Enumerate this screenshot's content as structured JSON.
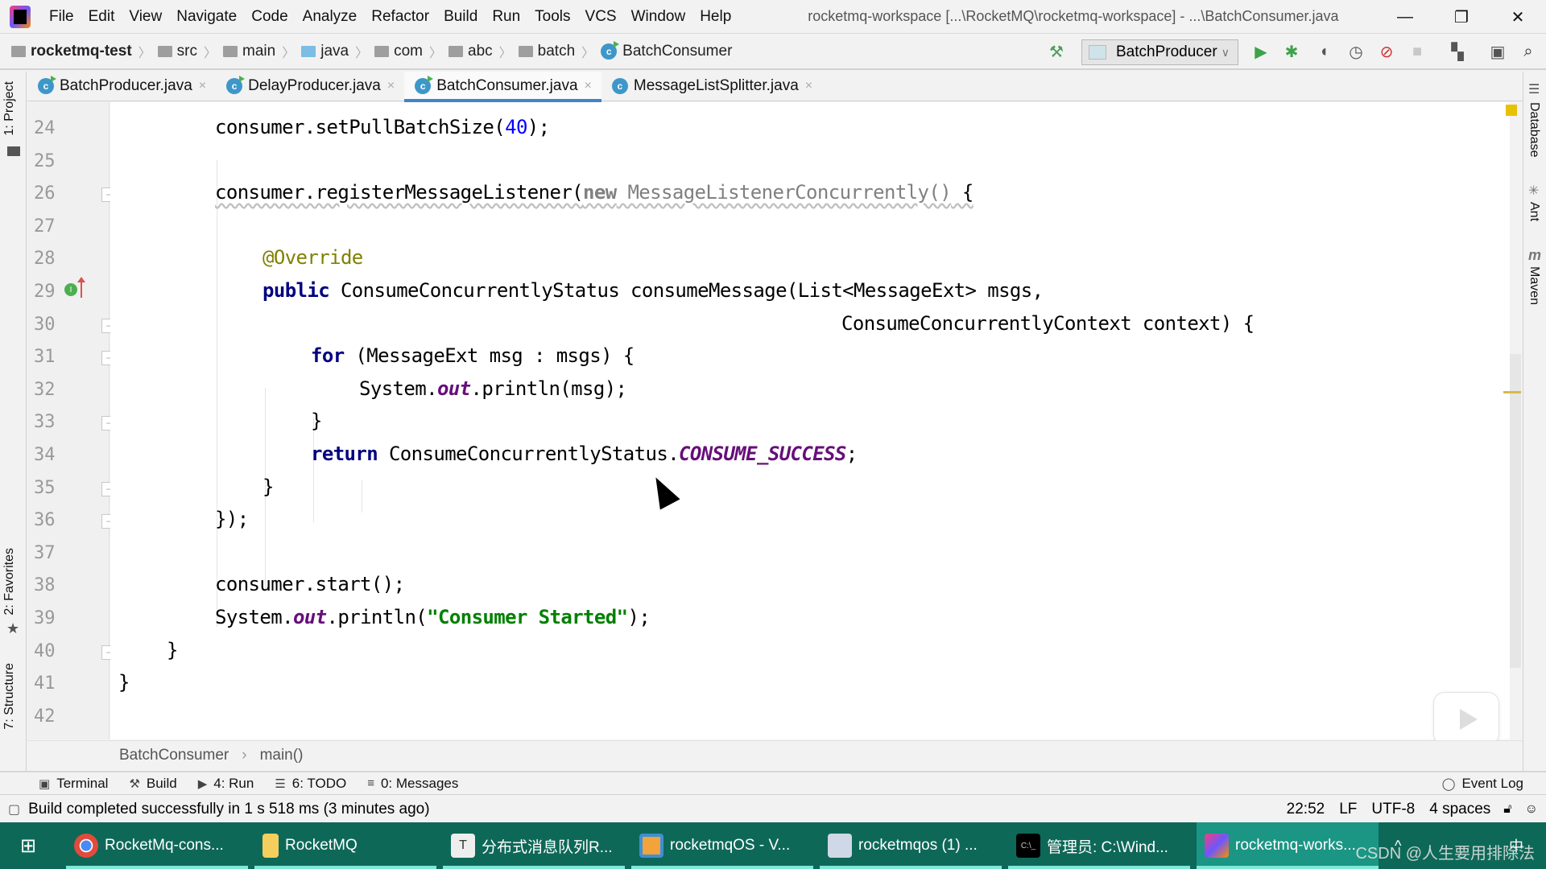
{
  "window": {
    "title": "rocketmq-workspace [...\\RocketMQ\\rocketmq-workspace] - ...\\BatchConsumer.java",
    "controls": {
      "minimize": "—",
      "restore": "❐",
      "close": "✕"
    }
  },
  "menu": [
    "File",
    "Edit",
    "View",
    "Navigate",
    "Code",
    "Analyze",
    "Refactor",
    "Build",
    "Run",
    "Tools",
    "VCS",
    "Window",
    "Help"
  ],
  "breadcrumb": [
    {
      "label": "rocketmq-test",
      "icon": "module-folder-icon"
    },
    {
      "label": "src",
      "icon": "folder-icon"
    },
    {
      "label": "main",
      "icon": "folder-icon"
    },
    {
      "label": "java",
      "icon": "source-folder-icon"
    },
    {
      "label": "com",
      "icon": "package-icon"
    },
    {
      "label": "abc",
      "icon": "package-icon"
    },
    {
      "label": "batch",
      "icon": "package-icon"
    },
    {
      "label": "BatchConsumer",
      "icon": "java-class-icon"
    }
  ],
  "toolbar": {
    "run_config": "BatchProducer",
    "icons": [
      "build-hammer-icon",
      "run-icon",
      "debug-icon",
      "coverage-icon",
      "profile-icon",
      "attach-debugger-icon",
      "stop-icon",
      "project-structure-icon",
      "sdk-icon",
      "search-icon"
    ]
  },
  "left_strip": [
    "1: Project",
    "2: Favorites",
    "7: Structure"
  ],
  "right_strip": [
    "Database",
    "Ant",
    "Maven"
  ],
  "tabs": [
    {
      "label": "BatchProducer.java",
      "active": false
    },
    {
      "label": "DelayProducer.java",
      "active": false
    },
    {
      "label": "BatchConsumer.java",
      "active": true
    },
    {
      "label": "MessageListSplitter.java",
      "active": false
    }
  ],
  "tab_close": "×",
  "editor": {
    "line_numbers": [
      "24",
      "25",
      "26",
      "27",
      "28",
      "29",
      "30",
      "31",
      "32",
      "33",
      "34",
      "35",
      "36",
      "37",
      "38",
      "39",
      "40",
      "41",
      "42"
    ],
    "lines": {
      "l24_a": "consumer.setPullBatchSize(",
      "l24_num": "40",
      "l24_b": ");",
      "l26_a": "consumer.registerMessageListener(",
      "l26_new": "new",
      "l26_cls": " MessageListenerConcurrently()",
      "l26_b": " {",
      "l28": "@Override",
      "l29_kw": "public",
      "l29_rest": " ConsumeConcurrentlyStatus consumeMessage(List<MessageExt> msgs,",
      "l30": "ConsumeConcurrentlyContext context) {",
      "l31_kw": "for",
      "l31_rest": " (MessageExt msg : msgs) {",
      "l32_a": "System.",
      "l32_out": "out",
      "l32_b": ".println(msg);",
      "l33": "}",
      "l34_kw": "return",
      "l34_a": " ConsumeConcurrentlyStatus.",
      "l34_const": "CONSUME_SUCCESS",
      "l34_b": ";",
      "l35": "}",
      "l36": "});",
      "l38": "consumer.start();",
      "l39_a": "System.",
      "l39_out": "out",
      "l39_b": ".println(",
      "l39_str": "\"Consumer Started\"",
      "l39_c": ");",
      "l40": "}",
      "l41": "}"
    },
    "gutter_marker_line": "29",
    "gutter_marker_label": "I"
  },
  "editor_breadcrumb": [
    "BatchConsumer",
    "main()"
  ],
  "tool_windows": [
    {
      "label": "Terminal",
      "icon": "terminal-icon"
    },
    {
      "label": "Build",
      "icon": "build-icon"
    },
    {
      "label": "4: Run",
      "icon": "run-icon"
    },
    {
      "label": "6: TODO",
      "icon": "todo-icon"
    },
    {
      "label": "0: Messages",
      "icon": "messages-icon"
    }
  ],
  "event_log": "Event Log",
  "status": {
    "message": "Build completed successfully in 1 s 518 ms (3 minutes ago)",
    "position": "22:52",
    "line_sep": "LF",
    "encoding": "UTF-8",
    "indent": "4 spaces"
  },
  "taskbar": {
    "items": [
      {
        "label": "RocketMq-cons...",
        "icon": "chrome-icon",
        "active": false
      },
      {
        "label": "RocketMQ",
        "icon": "file-explorer-icon",
        "active": false
      },
      {
        "label": "分布式消息队列R...",
        "icon": "typora-icon",
        "active": false
      },
      {
        "label": "rocketmqOS - V...",
        "icon": "virtualbox-icon",
        "active": false
      },
      {
        "label": "rocketmqos (1) ...",
        "icon": "remote-desktop-icon",
        "active": false
      },
      {
        "label": "管理员: C:\\Wind...",
        "icon": "cmd-icon",
        "active": false
      },
      {
        "label": "rocketmq-works...",
        "icon": "intellij-icon",
        "active": true
      }
    ],
    "tray_ime": "中",
    "watermark": "CSDN @人生要用排除法"
  },
  "colors": {
    "taskbar_bg": "#0e6858",
    "taskbar_active": "#1b9584",
    "tab_underline": "#4083c9",
    "keyword": "#000080",
    "annotation": "#808000",
    "string": "#008000",
    "static_field": "#660e7a",
    "number": "#0000ff"
  }
}
